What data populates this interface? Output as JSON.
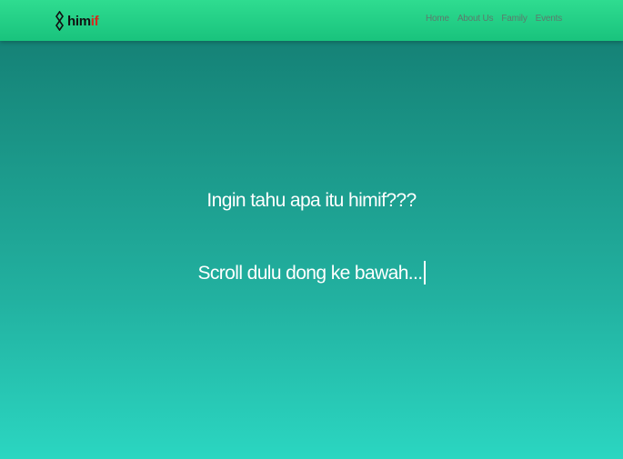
{
  "navbar": {
    "logo": {
      "text_dark": "him",
      "text_red": "if"
    },
    "links": [
      "Home",
      "About Us",
      "Family",
      "Events"
    ]
  },
  "hero": {
    "line1": "Ingin tahu apa itu himif???",
    "line2": "Scroll dulu dong ke bawah..."
  },
  "colors": {
    "navbar_top": "#2fdc90",
    "navbar_bottom": "#19c37d",
    "background_top": "#137a70",
    "background_bottom": "#2bd6c1",
    "logo_red": "#d42a1c",
    "nav_link": "#5d7a6d"
  }
}
